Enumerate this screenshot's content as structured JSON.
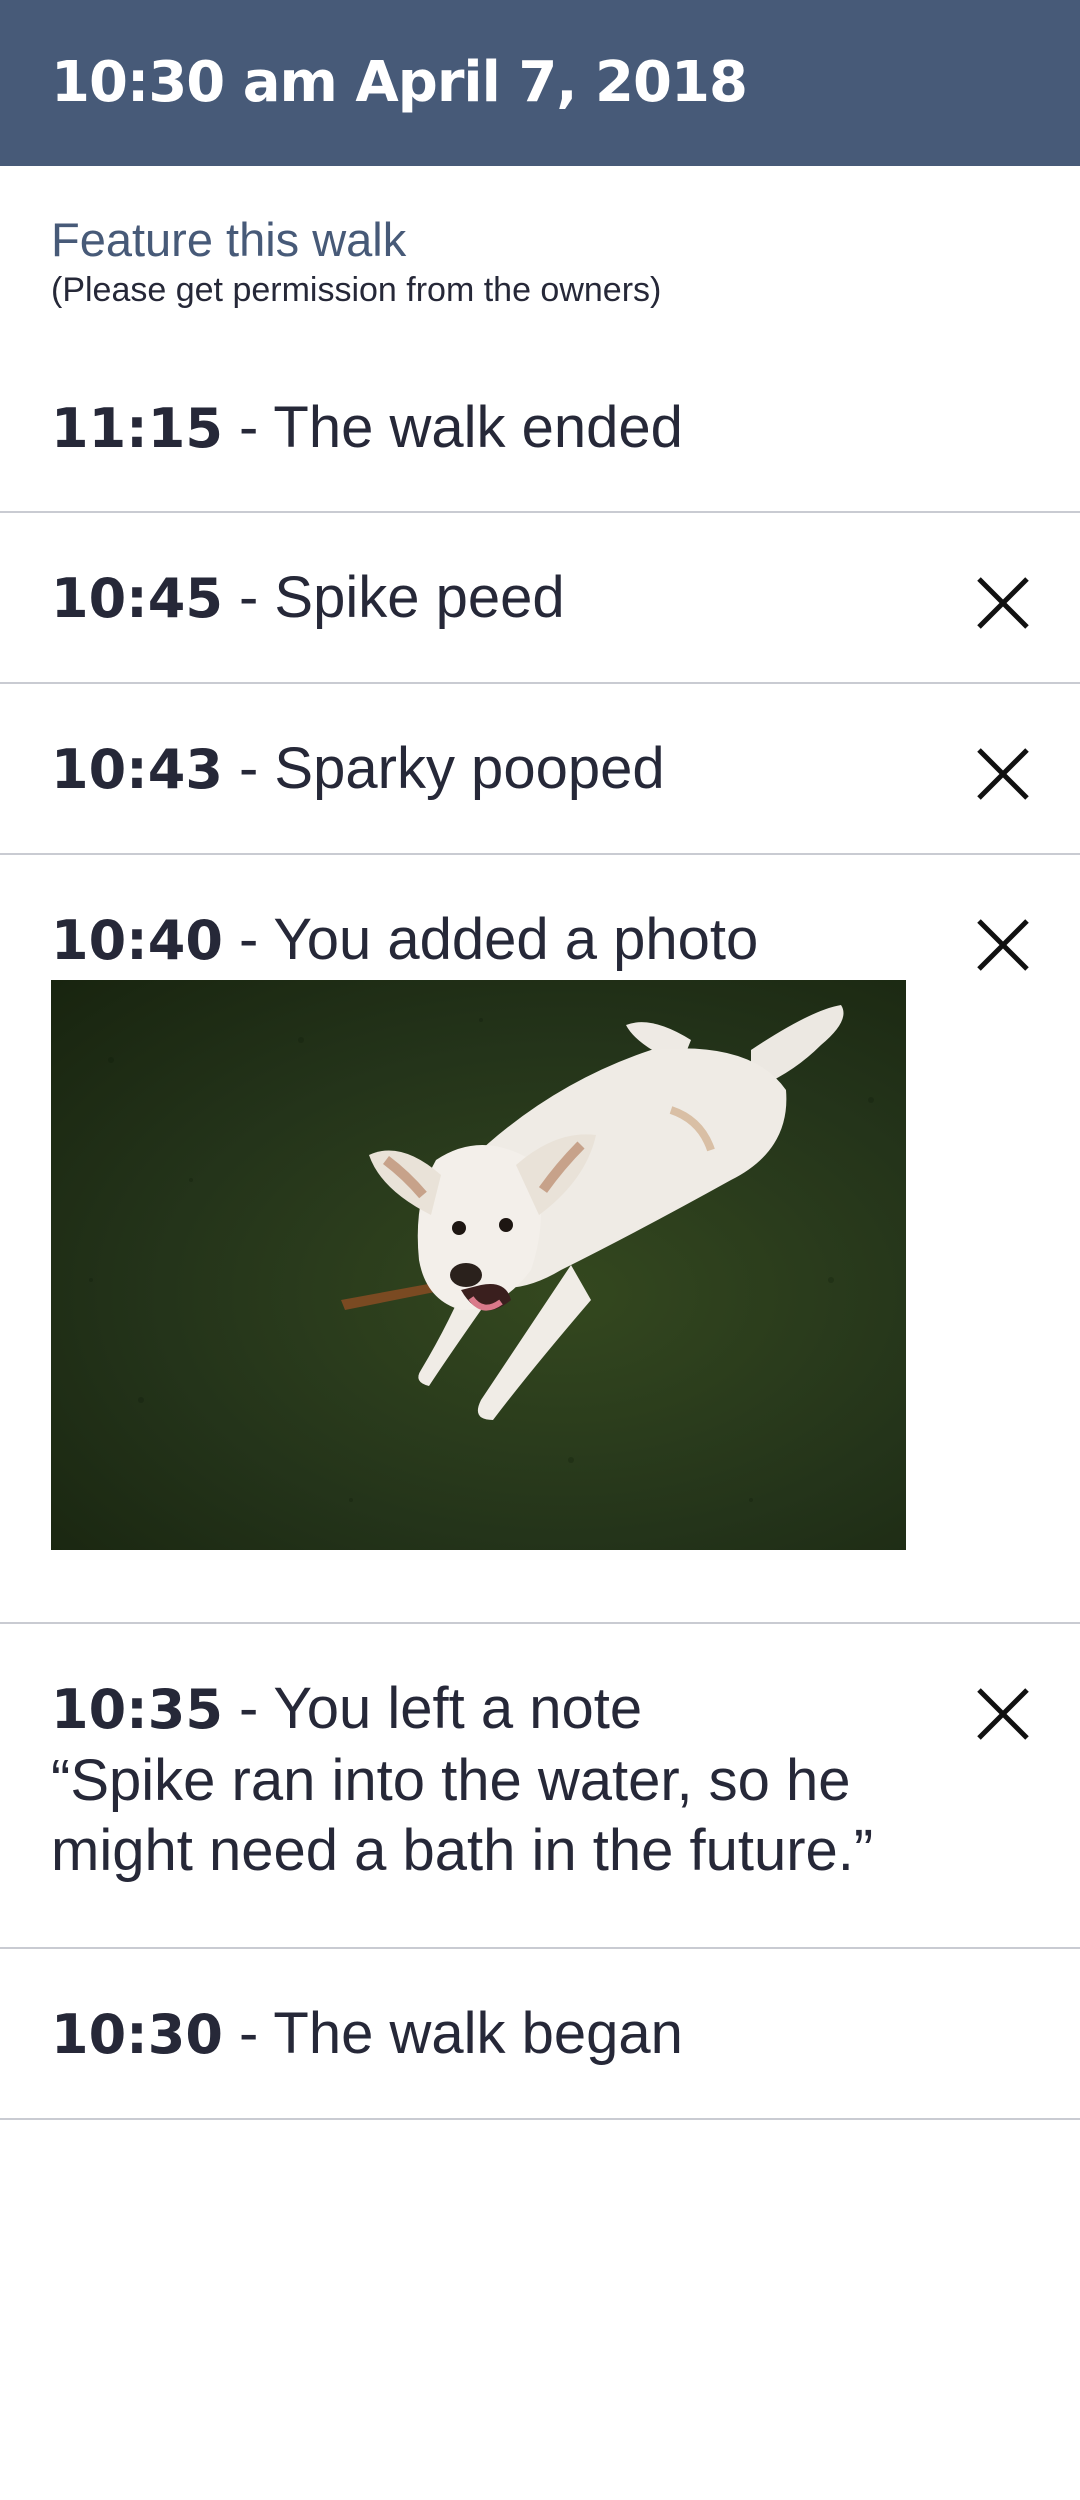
{
  "header": {
    "title": "10:30 am April 7, 2018"
  },
  "feature": {
    "link": "Feature this walk",
    "note": "(Please get permission from the owners)"
  },
  "events": [
    {
      "time": "11:15",
      "text": " - The walk ended",
      "removable": false
    },
    {
      "time": "10:45",
      "text": " - Spike peed",
      "removable": true
    },
    {
      "time": "10:43",
      "text": " - Sparky pooped",
      "removable": true
    },
    {
      "time": "10:40",
      "text": " - You added a photo",
      "removable": true
    },
    {
      "time": "10:35",
      "text": " - You left a note",
      "note": "“Spike ran into the water, so he might need a bath in the future.”",
      "removable": true
    },
    {
      "time": "10:30",
      "text": " - The walk began",
      "removable": false
    }
  ],
  "icons": {
    "remove": "close-icon"
  },
  "colors": {
    "header_bg": "#475a78",
    "accent": "#475a78",
    "text": "#262838",
    "divider": "#c9cbd2"
  }
}
